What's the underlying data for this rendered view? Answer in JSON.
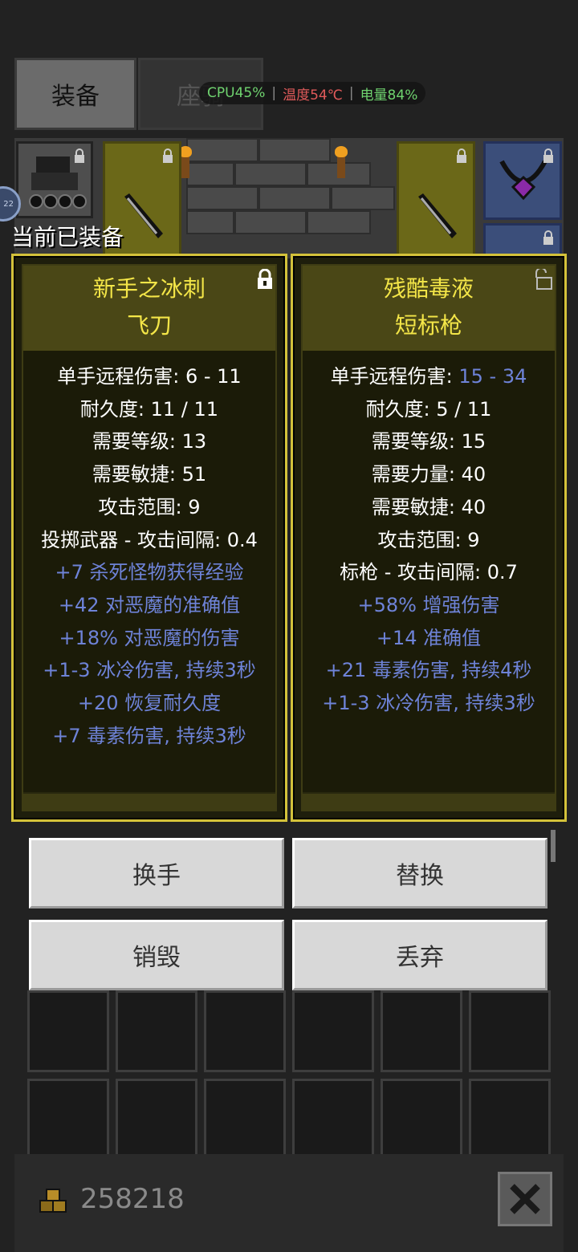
{
  "tabs": [
    {
      "label": "装备",
      "active": true
    },
    {
      "label": "座骑",
      "active": false
    }
  ],
  "status": {
    "cpu": "CPU45%",
    "temp": "温度54℃",
    "battery": "电量84%"
  },
  "equipped_label": "当前已装备",
  "level_badge": "22",
  "left_item": {
    "name_line1": "新手之冰刺",
    "name_line2": "飞刀",
    "locked": true,
    "stats": [
      "单手远程伤害: 6 - 11",
      "耐久度: 11 / 11",
      "需要等级: 13",
      "需要敏捷: 51",
      "攻击范围: 9",
      "投掷武器 - 攻击间隔: 0.4"
    ],
    "bonuses": [
      "+7 杀死怪物获得经验",
      "+42 对恶魔的准确值",
      "+18% 对恶魔的伤害",
      "+1-3 冰冷伤害, 持续3秒",
      "+20 恢复耐久度",
      "+7 毒素伤害, 持续3秒"
    ]
  },
  "right_item": {
    "name_line1": "残酷毒液",
    "name_line2": "短标枪",
    "locked": false,
    "damage_label": "单手远程伤害: ",
    "damage_value": "15 - 34",
    "stats": [
      "耐久度: 5 / 11",
      "需要等级: 15",
      "需要力量: 40",
      "需要敏捷: 40",
      "攻击范围: 9",
      "标枪 - 攻击间隔: 0.7"
    ],
    "bonuses": [
      "+58% 增强伤害",
      "+14 准确值",
      "+21 毒素伤害, 持续4秒",
      "+1-3 冰冷伤害, 持续3秒"
    ]
  },
  "buttons": {
    "swap_hand": "换手",
    "replace": "替换",
    "destroy": "销毁",
    "discard": "丢弃"
  },
  "gold": "258218",
  "colors": {
    "title_gold": "#f4e648",
    "bonus_blue": "#6e83d8",
    "panel_border": "#d4c23a"
  }
}
